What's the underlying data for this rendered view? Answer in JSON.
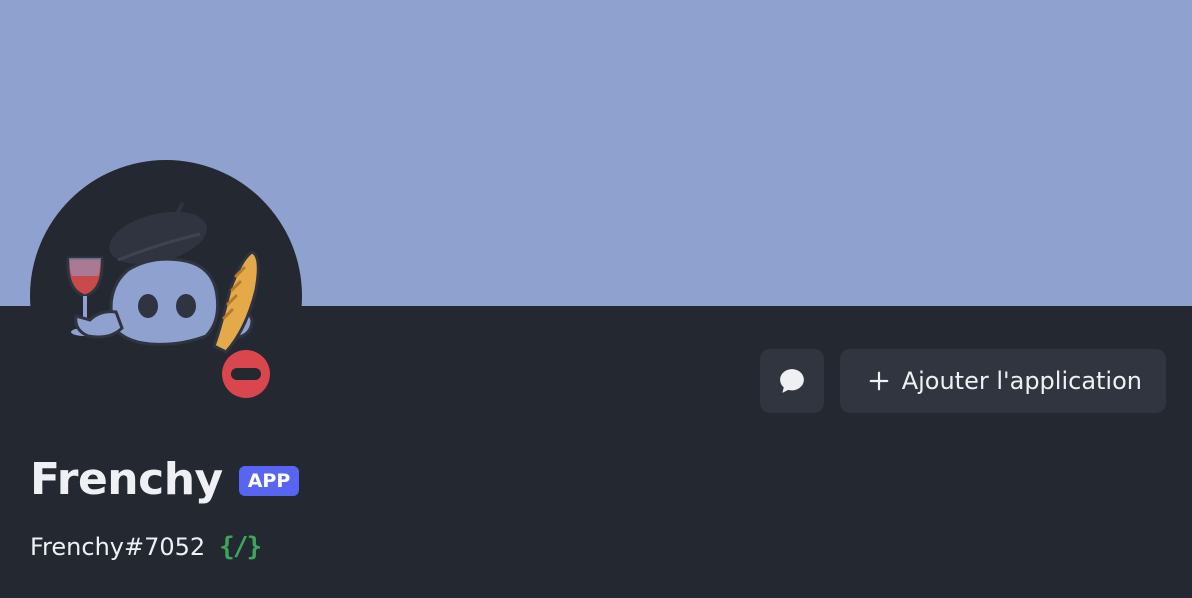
{
  "profile": {
    "display_name": "Frenchy",
    "badge_label": "APP",
    "username": "Frenchy#7052",
    "slash_commands_badge": "{/}",
    "status": "do-not-disturb"
  },
  "actions": {
    "message_icon": "chat-bubble-icon",
    "add_app_icon": "plus-icon",
    "add_app_label": "Ajouter l'application"
  },
  "colors": {
    "banner": "#8fa1cf",
    "background": "#232831",
    "button_bg": "#31353f",
    "badge_bg": "#5865f2",
    "status_dnd": "#d9464e",
    "slash_green": "#3ba55c",
    "text": "#eef0f3"
  }
}
